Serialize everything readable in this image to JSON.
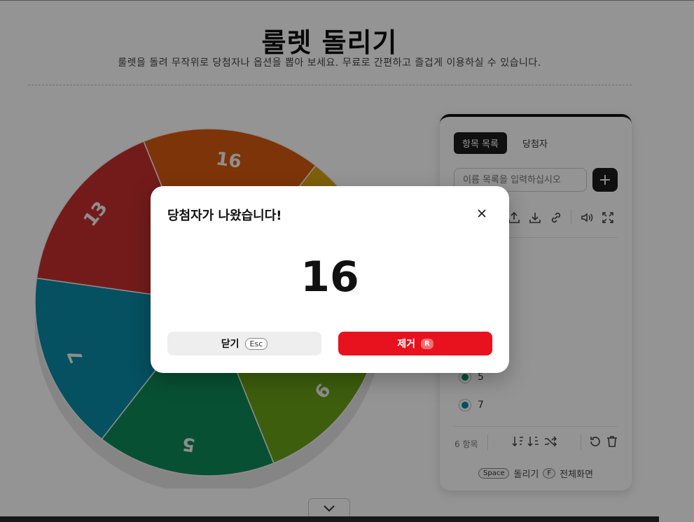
{
  "page": {
    "title": "룰렛 돌리기",
    "subtitle": "룰렛을 돌려 무작위로 당첨자나 옵션을 뽑아 보세요. 무료로 간편하고 즐겁게 이용하실 수 있습니다."
  },
  "wheel": {
    "segments": [
      {
        "label": "16",
        "color": "#d75a10"
      },
      {
        "label": "",
        "color": "#d9a414"
      },
      {
        "label": "9",
        "color": "#6aa317"
      },
      {
        "label": "5",
        "color": "#0f8a5a"
      },
      {
        "label": "7",
        "color": "#0a8aa8"
      },
      {
        "label": "13",
        "color": "#c72f2f"
      }
    ]
  },
  "panel": {
    "tabs": [
      {
        "label": "항목 목록",
        "active": true
      },
      {
        "label": "당첨자",
        "active": false
      }
    ],
    "input_placeholder": "이름 목록을 입력하십시오",
    "add_label": "+",
    "toolbar_icons": [
      "upload-icon",
      "download-icon",
      "link-icon",
      "sound-icon",
      "fullscreen-icon"
    ],
    "items": [
      {
        "label": "5",
        "color": "#0f8a5a"
      },
      {
        "label": "7",
        "color": "#0a8aa8"
      }
    ],
    "count_text": "6 항목",
    "footer": {
      "space_key": "Space",
      "spin_label": "돌리기",
      "f_key": "F",
      "fullscreen_label": "전체화면"
    }
  },
  "modal": {
    "title": "당첨자가 나왔습니다!",
    "result": "16",
    "close_label": "닫기",
    "close_key": "Esc",
    "remove_label": "제거",
    "remove_key": "R"
  }
}
